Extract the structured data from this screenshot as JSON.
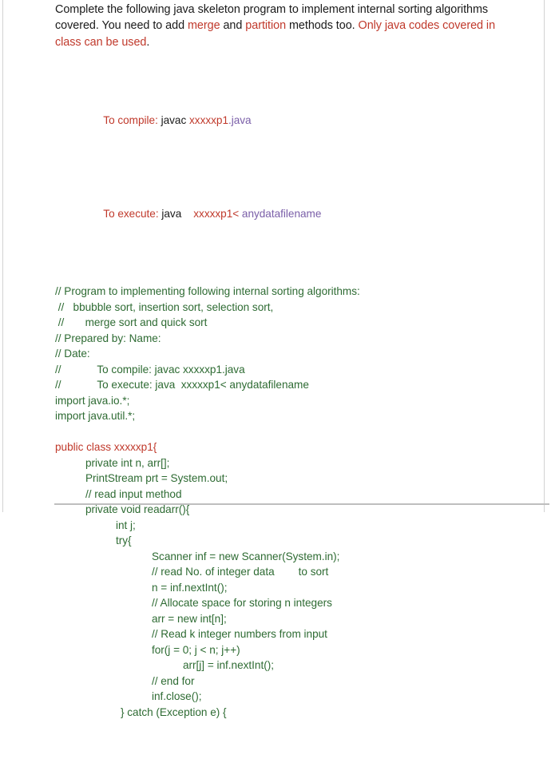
{
  "document": {
    "intro": {
      "segments": [
        {
          "text": "Complete the following java skeleton program to implement internal sorting algorithms covered. You need to add ",
          "color": "black"
        },
        {
          "text": "merge",
          "color": "red"
        },
        {
          "text": " and ",
          "color": "black"
        },
        {
          "text": "partition",
          "color": "red"
        },
        {
          "text": " methods too. ",
          "color": "black"
        },
        {
          "text": "Only java codes covered in class can be used",
          "color": "red"
        },
        {
          "text": ".",
          "color": "black"
        }
      ],
      "plain": "Complete the following java skeleton program to implement internal sorting algorithms covered. You need to add merge and partition methods too. Only java codes covered in class can be used."
    },
    "compile_line": {
      "label": "To compile:",
      "command": "javac ",
      "file": "xxxxxp1",
      "ext": ".java"
    },
    "execute_line": {
      "label": "To execute:",
      "command": "java ",
      "file": "   xxxxxp1<",
      "arg": " anydatafilename"
    },
    "code_lines": [
      {
        "indent": "i0",
        "text": "// Program to implementing following internal sorting algorithms:"
      },
      {
        "indent": "i0",
        "text": " //   bbubble sort, insertion sort, selection sort,"
      },
      {
        "indent": "i0",
        "text": " //       merge sort and quick sort"
      },
      {
        "indent": "i0",
        "text": "// Prepared by: Name:"
      },
      {
        "indent": "i0",
        "text": "// Date:"
      },
      {
        "indent": "i0",
        "text": "//            To compile: javac xxxxxp1.java"
      },
      {
        "indent": "i0",
        "text": "//            To execute: java  xxxxxp1< anydatafilename"
      },
      {
        "indent": "i0",
        "text": "import java.io.*;"
      },
      {
        "indent": "i0",
        "text": "import java.util.*;"
      },
      {
        "indent": "i0",
        "text": ""
      },
      {
        "indent": "i0",
        "text": "public class xxxxxp1{",
        "color": "red"
      },
      {
        "indent": "i1",
        "text": "private int n, arr[];"
      },
      {
        "indent": "i1",
        "text": "PrintStream prt = System.out;"
      },
      {
        "indent": "i1",
        "text": "// read input method"
      },
      {
        "indent": "i1",
        "text": "private void readarr(){"
      },
      {
        "indent": "i2",
        "text": "int j;"
      },
      {
        "indent": "i2",
        "text": "try{"
      },
      {
        "indent": "i3",
        "text": "Scanner inf = new Scanner(System.in);"
      },
      {
        "indent": "i3",
        "text": "// read No. of integer data        to sort"
      },
      {
        "indent": "i3",
        "text": "n = inf.nextInt();"
      },
      {
        "indent": "i3",
        "text": "// Allocate space for storing n integers"
      },
      {
        "indent": "i3",
        "text": "arr = new int[n];"
      },
      {
        "indent": "i3",
        "text": "// Read k integer numbers from input"
      },
      {
        "indent": "i3",
        "text": "for(j = 0; j < n; j++)"
      },
      {
        "indent": "i4",
        "text": "arr[j] = inf.nextInt();"
      },
      {
        "indent": "i3",
        "text": "// end for"
      },
      {
        "indent": "i3",
        "text": "inf.close();"
      },
      {
        "indent": "i-catch",
        "text": "} catch (Exception e) {"
      }
    ]
  },
  "colors": {
    "red": "#c0392b",
    "green": "#2e6b33",
    "purple": "#7a5ea8",
    "black": "#1a1a1a",
    "rule": "#bfbfbf",
    "page_edge": "#d2d2d2"
  }
}
